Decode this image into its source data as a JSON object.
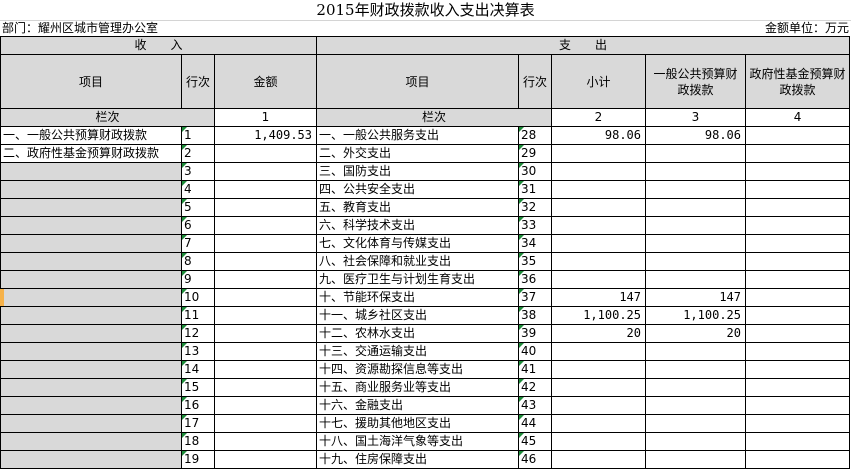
{
  "title": "2015年财政拨款收入支出决算表",
  "department": "部门：耀州区城市管理办公室",
  "unit": "金额单位：万元",
  "header": {
    "income": "收　　入",
    "expense": "支　　出",
    "item": "项目",
    "line_no": "行次",
    "amount": "金额",
    "subtotal": "小计",
    "general_budget": "一般公共预算财政拨款",
    "fund_budget": "政府性基金预算财政拨款"
  },
  "column_row": {
    "left_label": "栏次",
    "left_amount_col": "1",
    "right_label": "栏次",
    "col2": "2",
    "col3": "3",
    "col4": "4"
  },
  "rows": [
    {
      "inc_item": "一、一般公共预算财政拨款",
      "inc_line": "1",
      "inc_amount": "1,409.53",
      "exp_item": "一、一般公共服务支出",
      "exp_line": "28",
      "subtotal": "98.06",
      "general": "98.06",
      "fund": ""
    },
    {
      "inc_item": "二、政府性基金预算财政拨款",
      "inc_line": "2",
      "inc_amount": "",
      "exp_item": "二、外交支出",
      "exp_line": "29",
      "subtotal": "",
      "general": "",
      "fund": ""
    },
    {
      "inc_item": "",
      "inc_line": "3",
      "inc_amount": "",
      "exp_item": "三、国防支出",
      "exp_line": "30",
      "subtotal": "",
      "general": "",
      "fund": ""
    },
    {
      "inc_item": "",
      "inc_line": "4",
      "inc_amount": "",
      "exp_item": "四、公共安全支出",
      "exp_line": "31",
      "subtotal": "",
      "general": "",
      "fund": ""
    },
    {
      "inc_item": "",
      "inc_line": "5",
      "inc_amount": "",
      "exp_item": "五、教育支出",
      "exp_line": "32",
      "subtotal": "",
      "general": "",
      "fund": ""
    },
    {
      "inc_item": "",
      "inc_line": "6",
      "inc_amount": "",
      "exp_item": "六、科学技术支出",
      "exp_line": "33",
      "subtotal": "",
      "general": "",
      "fund": ""
    },
    {
      "inc_item": "",
      "inc_line": "7",
      "inc_amount": "",
      "exp_item": "七、文化体育与传媒支出",
      "exp_line": "34",
      "subtotal": "",
      "general": "",
      "fund": ""
    },
    {
      "inc_item": "",
      "inc_line": "8",
      "inc_amount": "",
      "exp_item": "八、社会保障和就业支出",
      "exp_line": "35",
      "subtotal": "",
      "general": "",
      "fund": ""
    },
    {
      "inc_item": "",
      "inc_line": "9",
      "inc_amount": "",
      "exp_item": "九、医疗卫生与计划生育支出",
      "exp_line": "36",
      "subtotal": "",
      "general": "",
      "fund": ""
    },
    {
      "inc_item": "",
      "inc_line": "10",
      "inc_amount": "",
      "exp_item": "十、节能环保支出",
      "exp_line": "37",
      "subtotal": "147",
      "general": "147",
      "fund": ""
    },
    {
      "inc_item": "",
      "inc_line": "11",
      "inc_amount": "",
      "exp_item": "十一、城乡社区支出",
      "exp_line": "38",
      "subtotal": "1,100.25",
      "general": "1,100.25",
      "fund": ""
    },
    {
      "inc_item": "",
      "inc_line": "12",
      "inc_amount": "",
      "exp_item": "十二、农林水支出",
      "exp_line": "39",
      "subtotal": "20",
      "general": "20",
      "fund": ""
    },
    {
      "inc_item": "",
      "inc_line": "13",
      "inc_amount": "",
      "exp_item": "十三、交通运输支出",
      "exp_line": "40",
      "subtotal": "",
      "general": "",
      "fund": ""
    },
    {
      "inc_item": "",
      "inc_line": "14",
      "inc_amount": "",
      "exp_item": "十四、资源勘探信息等支出",
      "exp_line": "41",
      "subtotal": "",
      "general": "",
      "fund": ""
    },
    {
      "inc_item": "",
      "inc_line": "15",
      "inc_amount": "",
      "exp_item": "十五、商业服务业等支出",
      "exp_line": "42",
      "subtotal": "",
      "general": "",
      "fund": ""
    },
    {
      "inc_item": "",
      "inc_line": "16",
      "inc_amount": "",
      "exp_item": "十六、金融支出",
      "exp_line": "43",
      "subtotal": "",
      "general": "",
      "fund": ""
    },
    {
      "inc_item": "",
      "inc_line": "17",
      "inc_amount": "",
      "exp_item": "十七、援助其他地区支出",
      "exp_line": "44",
      "subtotal": "",
      "general": "",
      "fund": ""
    },
    {
      "inc_item": "",
      "inc_line": "18",
      "inc_amount": "",
      "exp_item": "十八、国土海洋气象等支出",
      "exp_line": "45",
      "subtotal": "",
      "general": "",
      "fund": ""
    },
    {
      "inc_item": "",
      "inc_line": "19",
      "inc_amount": "",
      "exp_item": "十九、住房保障支出",
      "exp_line": "46",
      "subtotal": "",
      "general": "",
      "fund": ""
    }
  ],
  "colors": {
    "header_gray": "#d9d9d9",
    "cell_marker": "#1e8c3a",
    "row_selector": "#f6b24a"
  }
}
